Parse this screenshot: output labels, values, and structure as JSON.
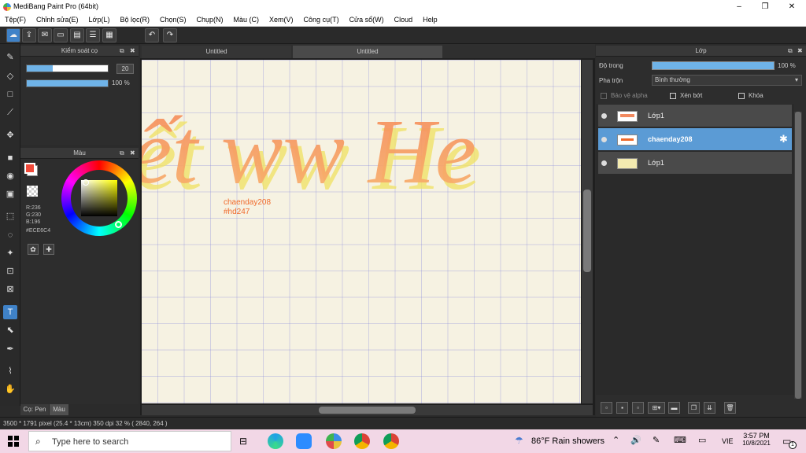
{
  "window": {
    "title": "MediBang Paint Pro (64bit)",
    "controls": [
      "–",
      "❐",
      "✕"
    ]
  },
  "menu": [
    "Tệp(F)",
    "Chỉnh sửa(E)",
    "Lớp(L)",
    "Bộ lọc(R)",
    "Chọn(S)",
    "Chụp(N)",
    "Màu (C)",
    "Xem(V)",
    "Công cụ(T)",
    "Cửa sổ(W)",
    "Cloud",
    "Help"
  ],
  "brush_panel": {
    "title": "Kiểm soát cọ",
    "size_value": "20",
    "opacity_value": "100 %",
    "size_fraction": 0.32,
    "opacity_fraction": 1.0
  },
  "color_panel": {
    "title": "Màu",
    "r_label": "R:236",
    "g_label": "G:230",
    "b_label": "B:196",
    "hex": "#ECE6C4",
    "foreground": "#f04a3a",
    "background": "#ffffff"
  },
  "tabs": {
    "pen": "Cọ: Pen",
    "color": "Màu"
  },
  "documents": [
    "Untitled",
    "Untitled"
  ],
  "canvas": {
    "lettering": "ết ww He",
    "note_line1": "chaenday208",
    "note_line2": "#hd247",
    "paper_color": "#f6f2e2"
  },
  "layers_panel": {
    "title": "Lớp",
    "opacity_label": "Độ trong",
    "opacity_value": "100 %",
    "blend_label": "Pha trộn",
    "blend_value": "Bình thường",
    "protect_alpha": "Bảo vệ alpha",
    "clip": "Xén bớt",
    "lock": "Khóa",
    "layers": [
      {
        "name": "Lớp1",
        "active": false
      },
      {
        "name": "chaenday208",
        "active": true
      },
      {
        "name": "Lớp1",
        "active": false
      }
    ]
  },
  "status": {
    "text": "3500 * 1791 pixel   (25.4 * 13cm)   350 dpi   32 %   ( 2840, 264 )"
  },
  "taskbar": {
    "search_placeholder": "Type here to search",
    "weather": "86°F  Rain showers",
    "lang": "VIE",
    "time": "3:57 PM",
    "date": "10/8/2021",
    "notif": "1"
  },
  "colors": {
    "accent": "#3f82c8",
    "letter_fill": "#f7a66a",
    "letter_shadow": "#f2e060"
  }
}
